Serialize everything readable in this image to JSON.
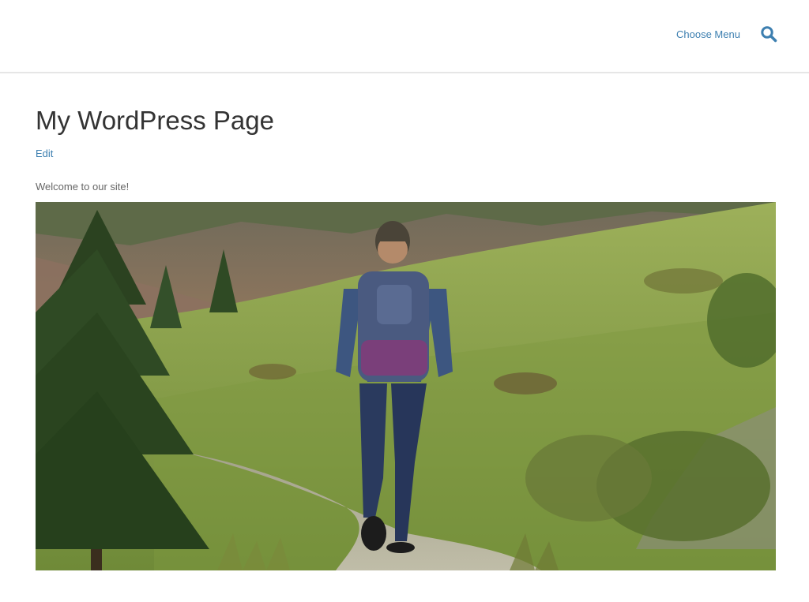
{
  "header": {
    "menu_label": "Choose Menu",
    "search_icon": "search-icon"
  },
  "page": {
    "title": "My WordPress Page",
    "edit_label": "Edit",
    "welcome_text": "Welcome to our site!"
  },
  "hero_image": {
    "subject": "hiker-photo",
    "colors": {
      "sky_hills": "#8a6a5a",
      "grass": "#8fa04a",
      "dark_tree": "#2f4a24",
      "jeans": "#2a3a5e",
      "backpack": "#4a5a80",
      "path": "#b7b0a2"
    }
  },
  "colors": {
    "link": "#3d7fb0",
    "title": "#333333",
    "text": "#666666",
    "divider": "#e6e6e6"
  }
}
